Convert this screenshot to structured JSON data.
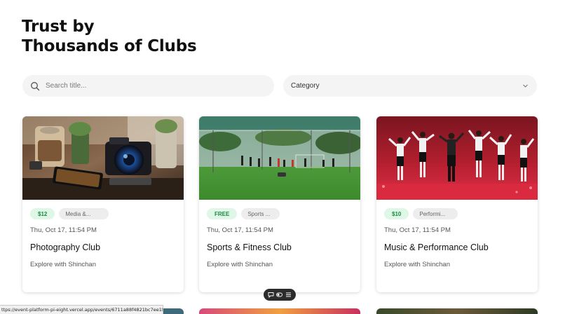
{
  "heading": {
    "line1": "Trust by",
    "line2": "Thousands of Clubs"
  },
  "search": {
    "placeholder": "Search title...",
    "icon": "search-icon"
  },
  "category_select": {
    "label": "Category",
    "icon": "chevron-down-icon"
  },
  "cards": [
    {
      "price": "$12",
      "category": "Media &...",
      "date": "Thu, Oct 17, 11:54 PM",
      "title": "Photography Club",
      "organizer": "Explore with Shinchan"
    },
    {
      "price": "FREE",
      "category": "Sports ...",
      "date": "Thu, Oct 17, 11:54 PM",
      "title": "Sports & Fitness Club",
      "organizer": "Explore with Shinchan"
    },
    {
      "price": "$10",
      "category": "Performi...",
      "date": "Thu, Oct 17, 11:54 PM",
      "title": "Music & Performance Club",
      "organizer": "Explore with Shinchan"
    }
  ],
  "toolbar": {
    "icons": [
      "comment-icon",
      "toggle-icon",
      "menu-icon"
    ]
  },
  "status_bar": {
    "url": "ttps://event-platform-pi-eight.vercel.app/events/6711a88f4821bc7ee1f58b9f"
  },
  "colors": {
    "price_badge_bg": "#dff7e6",
    "price_badge_text": "#1a8a40",
    "field_bg": "#f4f4f4"
  }
}
